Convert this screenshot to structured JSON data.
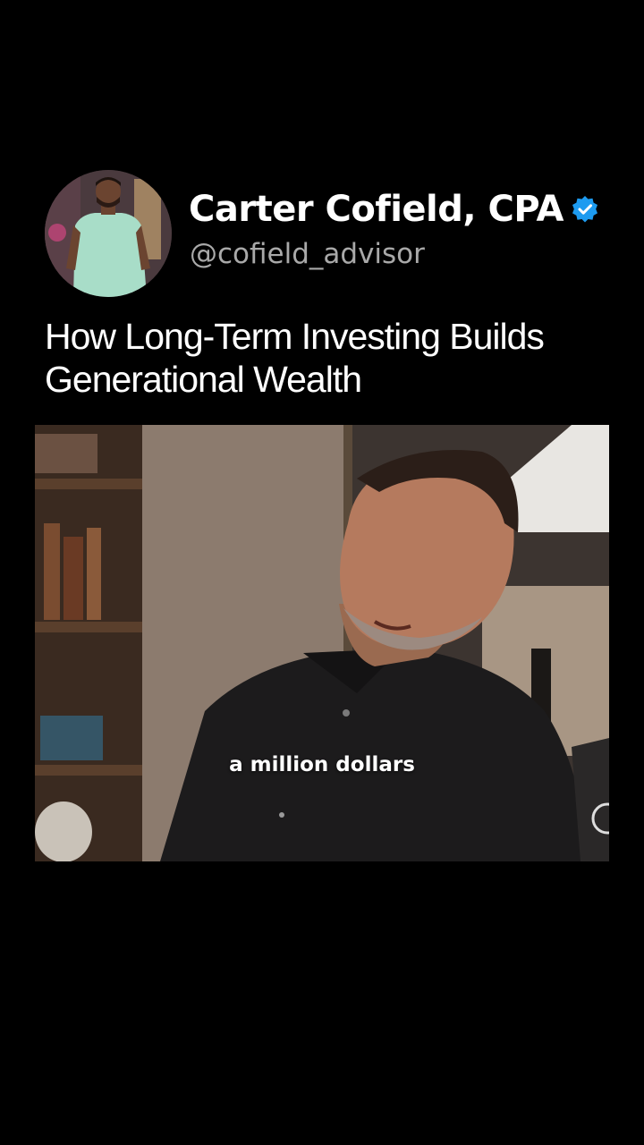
{
  "author": {
    "name": "Carter Cofield, CPA",
    "handle": "@cofield_advisor",
    "verified": true,
    "verified_color": "#1d9bf0",
    "avatar_icon": "profile-photo"
  },
  "post": {
    "title": "How Long-Term Investing Builds Generational Wealth"
  },
  "video": {
    "caption": "a million dollars"
  }
}
